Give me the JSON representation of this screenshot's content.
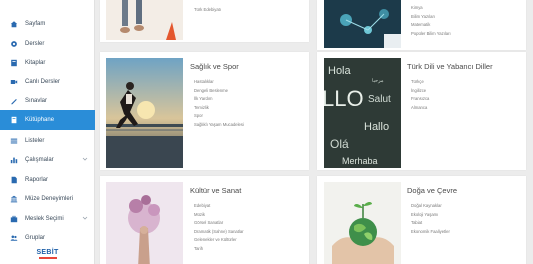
{
  "sidebar": {
    "items": [
      {
        "label": "Sayfam",
        "icon": "home-icon"
      },
      {
        "label": "Dersler",
        "icon": "gear-icon"
      },
      {
        "label": "Kitaplar",
        "icon": "book-icon"
      },
      {
        "label": "Canlı Dersler",
        "icon": "video-icon"
      },
      {
        "label": "Sınavlar",
        "icon": "pencil-icon"
      },
      {
        "label": "Kütüphane",
        "icon": "library-icon",
        "active": true
      },
      {
        "label": "Listeler",
        "icon": "list-icon"
      },
      {
        "label": "Çalışmalar",
        "icon": "chart-icon",
        "expandable": true
      },
      {
        "label": "Raporlar",
        "icon": "report-icon"
      },
      {
        "label": "Müze Deneyimleri",
        "icon": "museum-icon"
      },
      {
        "label": "Meslek Seçimi",
        "icon": "briefcase-icon",
        "expandable": true
      },
      {
        "label": "Gruplar",
        "icon": "group-icon"
      }
    ],
    "logo": "SEBİT"
  },
  "colors": {
    "accent": "#2a8dd8",
    "sidebar_text": "#3a4a5a",
    "brand": "#1d5fa8"
  },
  "top_cards": [
    {
      "items": [
        "Türk Edebiyatı"
      ]
    },
    {
      "items": [
        "Kimya",
        "Bilim Yazıları",
        "Matematik",
        "Popüler Bilim Yazıları"
      ]
    }
  ],
  "cards": [
    {
      "title": "Sağlık ve Spor",
      "items": [
        "Hastalıklar",
        "Dengeli Beslenme",
        "İlk Yardım",
        "Temizlik",
        "Spor",
        "Sağlıklı Yaşam Mucadelesi"
      ]
    },
    {
      "title": "Türk Dili ve Yabancı Diller",
      "items": [
        "Türkçe",
        "İngilizce",
        "Fransızca",
        "Almanca"
      ]
    },
    {
      "title": "Kültür ve Sanat",
      "items": [
        "Edebiyat",
        "Müzik",
        "Görsel Sanatlar",
        "Dramatik (Sahne) Sanatlar",
        "Gelenekler ve Kültürler",
        "Tarih"
      ]
    },
    {
      "title": "Doğa ve Çevre",
      "items": [
        "Doğal Kaynaklar",
        "Ekoloji Yaşamı",
        "Tabiat",
        "Ekonomik Faaliyetler"
      ]
    }
  ],
  "language_card_words": [
    "Hola",
    "Hello",
    "Salut",
    "LLO",
    "Hallo",
    "Olá",
    "Merhaba"
  ]
}
